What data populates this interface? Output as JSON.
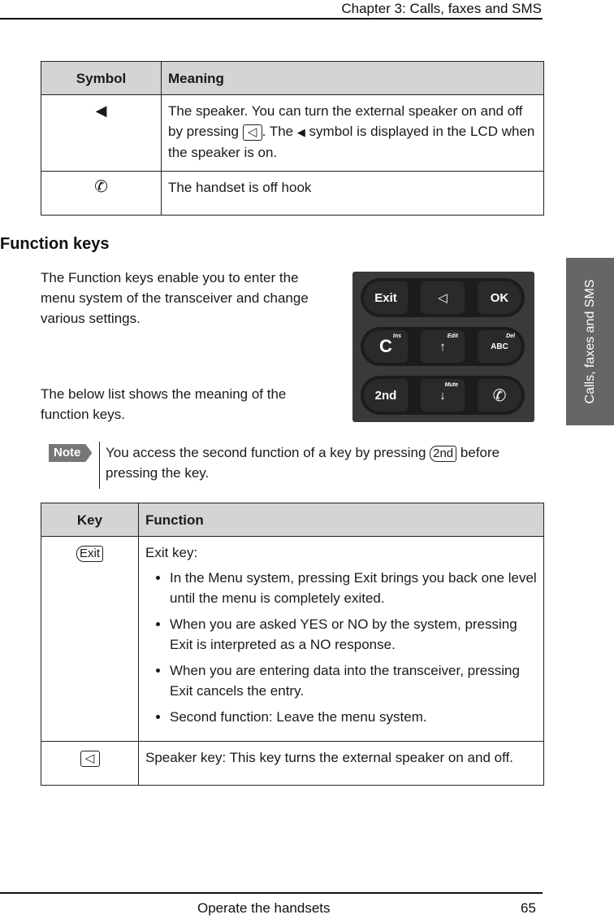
{
  "header": {
    "chapter_title": "Chapter 3:  Calls, faxes and SMS"
  },
  "side_tab": {
    "label": "Calls, faxes and SMS"
  },
  "symbol_table": {
    "headers": [
      "Symbol",
      "Meaning"
    ],
    "rows": [
      {
        "icon": "speaker-icon",
        "glyph": "◀",
        "text_before": "The speaker. You can turn the external speaker on and off by pressing ",
        "key_glyph": "◁",
        "text_mid": ". The ",
        "inline_glyph": "◀",
        "text_after": " symbol is displayed in the LCD when the speaker is on."
      },
      {
        "icon": "handset-off-hook-icon",
        "glyph": "✆",
        "text": "The handset is off hook"
      }
    ]
  },
  "section": {
    "heading": "Function keys",
    "para1": "The Function keys enable you to enter the menu system of the transceiver and change various settings.",
    "para2": "The below list shows the meaning of the function keys."
  },
  "keypad_image": {
    "rows": [
      [
        {
          "label": "Exit"
        },
        {
          "label": "◁"
        },
        {
          "label": "OK"
        }
      ],
      [
        {
          "label": "C",
          "sub": "Ins"
        },
        {
          "label": "↑",
          "sub": "Edit"
        },
        {
          "label": "ABC",
          "sub": "Del"
        }
      ],
      [
        {
          "label": "2nd"
        },
        {
          "label": "↓",
          "sub": "Mute"
        },
        {
          "label": "✆"
        }
      ]
    ]
  },
  "note": {
    "badge": "Note",
    "text_before": "You access the second function of a key by pressing ",
    "key": "2nd",
    "text_after": " before pressing the key."
  },
  "key_table": {
    "headers": [
      "Key",
      "Function"
    ],
    "rows": [
      {
        "key": "Exit",
        "title": "Exit key:",
        "bullets": [
          "In the Menu system, pressing Exit brings you back one level until the menu is completely exited.",
          "When you are asked YES or NO by the system, pressing Exit is interpreted as a NO response.",
          "When you are entering data into the transceiver, pressing Exit cancels the entry.",
          "Second function: Leave the menu system."
        ]
      },
      {
        "key": "◁",
        "text": "Speaker key: This key turns the external speaker on and off."
      }
    ]
  },
  "footer": {
    "section": "Operate the handsets",
    "page": "65"
  }
}
